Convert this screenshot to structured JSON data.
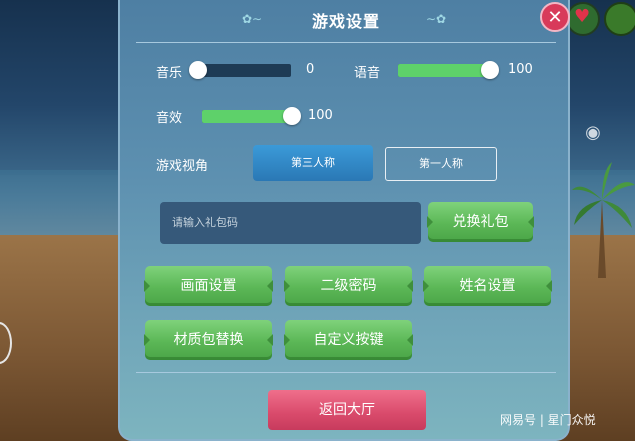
{
  "panel": {
    "title": "游戏设置",
    "close_icon": "close-x-icon"
  },
  "audio": {
    "music": {
      "label": "音乐",
      "value": "0",
      "level_percent": 0
    },
    "voice": {
      "label": "语音",
      "value": "100",
      "level_percent": 100
    },
    "sfx": {
      "label": "音效",
      "value": "100",
      "level_percent": 100
    }
  },
  "view": {
    "label": "游戏视角",
    "options": [
      "第三人称",
      "第一人称"
    ],
    "selected": "第三人称"
  },
  "gift": {
    "placeholder": "请输入礼包码",
    "button": "兑换礼包"
  },
  "buttons": {
    "graphics": "画面设置",
    "secondary_password": "二级密码",
    "name_settings": "姓名设置",
    "texture_pack": "材质包替换",
    "custom_keys": "自定义按键"
  },
  "return_button": "返回大厅",
  "watermark": "网易号 | 星门众悦",
  "colors": {
    "slider_fill": "#5ed16a",
    "green_button": "#5bb756",
    "return_button": "#d94a6b",
    "selected_option": "#2a78b5"
  }
}
